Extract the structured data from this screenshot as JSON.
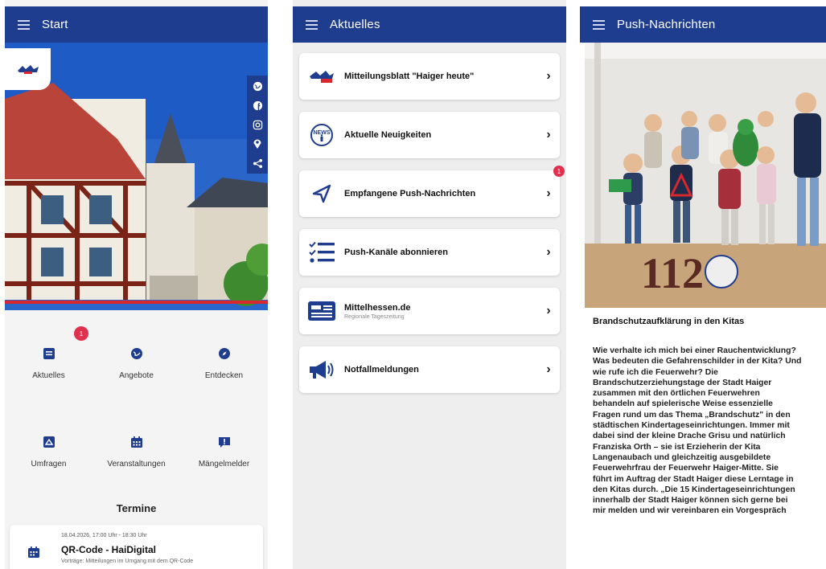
{
  "screen1": {
    "title": "Start",
    "social_icons": [
      "globe-icon",
      "facebook-icon",
      "instagram-icon",
      "location-pin-icon",
      "share-icon"
    ],
    "tiles": [
      {
        "label": "Aktuelles",
        "icon": "news-icon",
        "badge": "1"
      },
      {
        "label": "Angebote",
        "icon": "globe-icon"
      },
      {
        "label": "Entdecken",
        "icon": "compass-icon"
      },
      {
        "label": "Umfragen",
        "icon": "poll-icon"
      },
      {
        "label": "Veranstaltungen",
        "icon": "calendar-icon"
      },
      {
        "label": "Mängelmelder",
        "icon": "report-icon"
      }
    ],
    "termine_heading": "Termine",
    "termin": {
      "date": "18.04.2026, 17:00 Uhr - 18:30 Uhr",
      "name": "QR-Code - HaiDigital",
      "desc": "Vorträge: Mitteilungen im Umgang mit dem QR-Code"
    }
  },
  "screen2": {
    "title": "Aktuelles",
    "items": [
      {
        "label": "Mitteilungsblatt \"Haiger heute\"",
        "icon": "haiger-logo-icon"
      },
      {
        "label": "Aktuelle Neuigkeiten",
        "icon": "news-icon"
      },
      {
        "label": "Empfangene Push-Nachrichten",
        "icon": "send-icon",
        "badge": "1"
      },
      {
        "label": "Push-Kanäle abonnieren",
        "icon": "checklist-icon"
      },
      {
        "label": "Mittelhessen.de",
        "sub": "Regionale Tageszeitung",
        "icon": "newspaper-icon"
      },
      {
        "label": "Notfallmeldungen",
        "icon": "megaphone-icon"
      }
    ]
  },
  "screen3": {
    "title": "Push-Nachrichten",
    "news_title": "Brandschutzaufklärung in den Kitas",
    "news_body": "Wie verhalte ich mich bei einer Rauchentwicklung?\nWas bedeuten die Gefahrenschilder in der Kita? Und\nwie rufe ich die Feuerwehr? Die\nBrandschutzerziehungstage der Stadt Haiger\nzusammen mit den örtlichen Feuerwehren\nbehandeln auf spielerische Weise essenzielle\nFragen rund um das Thema „Brandschutz\" in den\nstädtischen Kindertageseinrichtungen. Immer mit\ndabei sind der kleine Drache Grisu und natürlich\nFranziska Orth – sie ist Erzieherin der Kita\nLangenaubach und gleichzeitig ausgebildete\nFeuerwehrfrau der Feuerwehr Haiger-Mitte. Sie\nführt im Auftrag der Stadt Haiger diese Lerntage in\nden Kitas durch. „Die 15 Kindertageseinrichtungen\ninnerhalb der Stadt Haiger können sich gerne bei\nmir melden und wir vereinbaren ein Vorgespräch",
    "photo_caption_number": "112"
  },
  "colors": {
    "primary": "#1f3d8f",
    "badge": "#e0304e",
    "accent_red": "#d9272e"
  }
}
